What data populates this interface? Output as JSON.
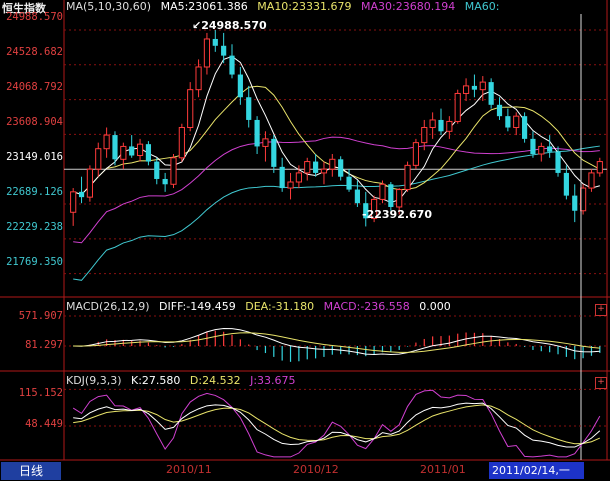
{
  "title": "恒生指数",
  "ma_header": {
    "label": "MA(5,10,30,60)",
    "ma5": "MA5:23061.386",
    "ma10": "MA10:23331.679",
    "ma30": "MA30:23680.194",
    "ma60": "MA60:"
  },
  "macd_header": {
    "label": "MACD(26,12,9)",
    "diff": "DIFF:-149.459",
    "dea": "DEA:-31.180",
    "macd": "MACD:-236.558",
    "zero": "0.000"
  },
  "kdj_header": {
    "label": "KDJ(9,3,3)",
    "k": "K:27.580",
    "d": "D:24.532",
    "j": "J:33.675"
  },
  "price_axis": [
    "24988.570",
    "24528.682",
    "24068.792",
    "23608.904",
    "23149.016",
    "22689.126",
    "22229.238",
    "21769.350"
  ],
  "macd_axis": [
    "571.907",
    "81.297"
  ],
  "kdj_axis": [
    "115.152",
    "48.449"
  ],
  "annotations": {
    "high": "24988.570",
    "low": "22392.670"
  },
  "period_tab": "日线",
  "dates": [
    "2010/11",
    "2010/12",
    "2011/01"
  ],
  "selected_date": "2011/02/14,一",
  "colors": {
    "up": "#ff3b3b",
    "down": "#34d6e0",
    "ma5": "#ffffff",
    "ma10": "#e8e36a",
    "ma30": "#d040d0",
    "ma60": "#40c8d0",
    "grid": "#8a1010"
  },
  "chart_data": [
    {
      "type": "candlestick",
      "title": "恒生指数",
      "ylim": [
        21500,
        25200
      ],
      "marked_high": 24988.57,
      "marked_low": 22392.67,
      "series": [
        {
          "name": "MA5",
          "last": 23061.386
        },
        {
          "name": "MA10",
          "last": 23331.679
        },
        {
          "name": "MA30",
          "last": 23680.194
        },
        {
          "name": "MA60"
        }
      ],
      "ohlc": [
        [
          22580,
          22900,
          22400,
          22850
        ],
        [
          22850,
          23050,
          22700,
          22780
        ],
        [
          22780,
          23200,
          22720,
          23150
        ],
        [
          23150,
          23500,
          23050,
          23420
        ],
        [
          23420,
          23700,
          23300,
          23600
        ],
        [
          23600,
          23650,
          23200,
          23280
        ],
        [
          23280,
          23500,
          23150,
          23450
        ],
        [
          23450,
          23600,
          23300,
          23330
        ],
        [
          23330,
          23550,
          23250,
          23480
        ],
        [
          23480,
          23520,
          23200,
          23250
        ],
        [
          23250,
          23300,
          22950,
          23020
        ],
        [
          23020,
          23100,
          22850,
          22950
        ],
        [
          22950,
          23350,
          22900,
          23300
        ],
        [
          23300,
          23750,
          23250,
          23700
        ],
        [
          23700,
          24300,
          23650,
          24200
        ],
        [
          24200,
          24600,
          24100,
          24500
        ],
        [
          24500,
          24950,
          24400,
          24870
        ],
        [
          24870,
          24988.57,
          24700,
          24780
        ],
        [
          24780,
          24950,
          24550,
          24650
        ],
        [
          24650,
          24800,
          24350,
          24400
        ],
        [
          24400,
          24500,
          24000,
          24100
        ],
        [
          24100,
          24250,
          23700,
          23800
        ],
        [
          23800,
          23850,
          23350,
          23450
        ],
        [
          23450,
          23650,
          23250,
          23550
        ],
        [
          23550,
          23600,
          23100,
          23180
        ],
        [
          23180,
          23300,
          22850,
          22900
        ],
        [
          22900,
          23100,
          22750,
          22980
        ],
        [
          22980,
          23200,
          22900,
          23100
        ],
        [
          23100,
          23300,
          23000,
          23250
        ],
        [
          23250,
          23350,
          23050,
          23100
        ],
        [
          23100,
          23250,
          22950,
          23150
        ],
        [
          23150,
          23350,
          23050,
          23280
        ],
        [
          23280,
          23320,
          23000,
          23050
        ],
        [
          23050,
          23150,
          22850,
          22880
        ],
        [
          22880,
          23000,
          22650,
          22700
        ],
        [
          22700,
          22850,
          22392.67,
          22500
        ],
        [
          22500,
          22800,
          22450,
          22750
        ],
        [
          22750,
          23000,
          22700,
          22950
        ],
        [
          22950,
          22980,
          22600,
          22650
        ],
        [
          22650,
          22900,
          22550,
          22880
        ],
        [
          22880,
          23250,
          22850,
          23200
        ],
        [
          23200,
          23550,
          23150,
          23500
        ],
        [
          23500,
          23800,
          23400,
          23700
        ],
        [
          23700,
          23900,
          23550,
          23800
        ],
        [
          23800,
          23950,
          23600,
          23650
        ],
        [
          23650,
          23850,
          23550,
          23780
        ],
        [
          23780,
          24200,
          23750,
          24150
        ],
        [
          24150,
          24350,
          24050,
          24250
        ],
        [
          24250,
          24400,
          24100,
          24200
        ],
        [
          24200,
          24380,
          24050,
          24300
        ],
        [
          24300,
          24350,
          23950,
          24000
        ],
        [
          24000,
          24100,
          23800,
          23850
        ],
        [
          23850,
          23950,
          23650,
          23700
        ],
        [
          23700,
          23900,
          23600,
          23850
        ],
        [
          23850,
          23900,
          23500,
          23550
        ],
        [
          23550,
          23650,
          23300,
          23350
        ],
        [
          23350,
          23500,
          23250,
          23450
        ],
        [
          23450,
          23600,
          23300,
          23380
        ],
        [
          23380,
          23450,
          23050,
          23100
        ],
        [
          23100,
          23200,
          22750,
          22800
        ],
        [
          22800,
          22950,
          22450,
          22600
        ],
        [
          22600,
          22950,
          22550,
          22900
        ],
        [
          22900,
          23150,
          22850,
          23100
        ],
        [
          23100,
          23300,
          23050,
          23250
        ]
      ]
    },
    {
      "type": "bar",
      "title": "MACD(26,12,9)",
      "ylim": [
        -300,
        650
      ],
      "series": [
        {
          "name": "DIFF",
          "last": -149.459
        },
        {
          "name": "DEA",
          "last": -31.18
        },
        {
          "name": "MACD",
          "last": -236.558
        }
      ]
    },
    {
      "type": "line",
      "title": "KDJ(9,3,3)",
      "ylim": [
        -10,
        125
      ],
      "series": [
        {
          "name": "K",
          "last": 27.58
        },
        {
          "name": "D",
          "last": 24.532
        },
        {
          "name": "J",
          "last": 33.675
        }
      ]
    }
  ]
}
